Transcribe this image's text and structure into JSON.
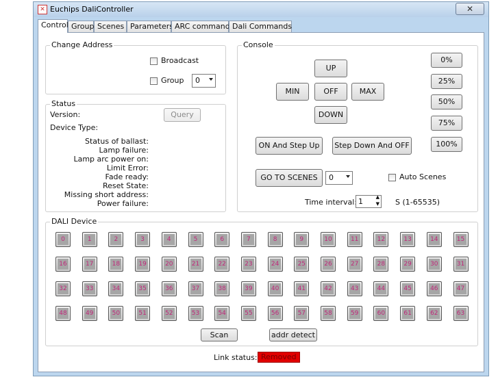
{
  "window": {
    "title": "Euchips DaliController",
    "close_glyph": "✕"
  },
  "tabs": [
    "Control",
    "Group",
    "Scenes",
    "Parameters",
    "ARC command",
    "Dali Commands"
  ],
  "change_address": {
    "title": "Change Address",
    "broadcast_label": "Broadcast",
    "group_label": "Group",
    "group_value": "0"
  },
  "status": {
    "title": "Status",
    "version_label": "Version:",
    "device_type_label": "Device Type:",
    "query_label": "Query",
    "items": [
      "Status of ballast:",
      "Lamp failure:",
      "Lamp arc power on:",
      "Limit Error:",
      "Fade ready:",
      "Reset State:",
      "Missing short address:",
      "Power failure:"
    ]
  },
  "console": {
    "title": "Console",
    "up": "UP",
    "min": "MIN",
    "off": "OFF",
    "max": "MAX",
    "down": "DOWN",
    "on_step_up": "ON And Step Up",
    "step_down_off": "Step Down And OFF",
    "go_to_scenes": "GO TO SCENES",
    "scene_value": "0",
    "auto_scenes": "Auto Scenes",
    "time_interval_label": "Time interval:",
    "time_interval_value": "1",
    "time_range": "S (1-65535)",
    "percents": [
      "0%",
      "25%",
      "50%",
      "75%",
      "100%"
    ]
  },
  "dali_device": {
    "title": "DALI Device",
    "devices": [
      "0",
      "1",
      "2",
      "3",
      "4",
      "5",
      "6",
      "7",
      "8",
      "9",
      "10",
      "11",
      "12",
      "13",
      "14",
      "15",
      "16",
      "17",
      "18",
      "19",
      "20",
      "21",
      "22",
      "23",
      "24",
      "25",
      "26",
      "27",
      "28",
      "29",
      "30",
      "31",
      "32",
      "33",
      "34",
      "35",
      "36",
      "37",
      "38",
      "39",
      "40",
      "41",
      "42",
      "43",
      "44",
      "45",
      "46",
      "47",
      "48",
      "49",
      "50",
      "51",
      "52",
      "53",
      "54",
      "55",
      "56",
      "57",
      "58",
      "59",
      "60",
      "61",
      "62",
      "63"
    ],
    "scan_label": "Scan",
    "addr_detect_label": "addr detect"
  },
  "link": {
    "label": "Link status:",
    "value": "Removed"
  }
}
